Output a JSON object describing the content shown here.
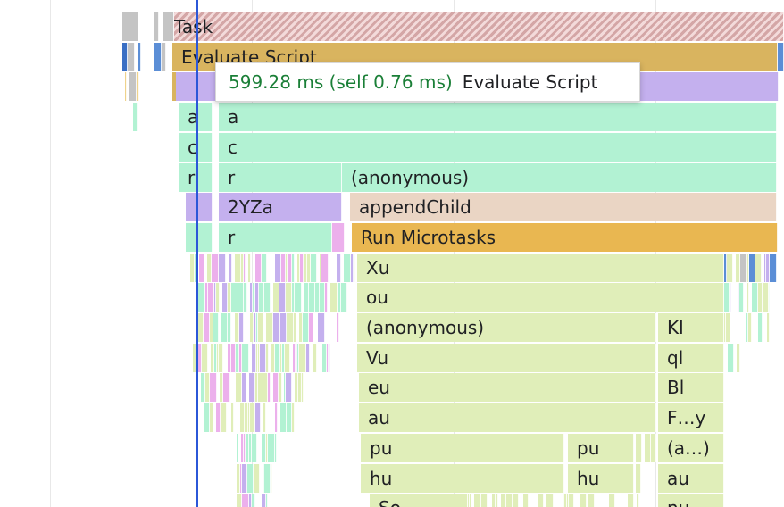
{
  "tooltip": {
    "time": "599.28 ms (self 0.76 ms)",
    "name": "Evaluate Script"
  },
  "labels": {
    "task": "Task",
    "evaluate_script": "Evaluate Script",
    "a_small": "a",
    "a": "a",
    "c_small": "c",
    "c": "c",
    "r_small": "r",
    "r": "r",
    "anonymous": "(anonymous)",
    "twoyza": "2YZa",
    "append_child": "appendChild",
    "r2": "r",
    "run_microtasks": "Run Microtasks",
    "xu": "Xu",
    "ou": "ou",
    "anonymous2": "(anonymous)",
    "kl": "Kl",
    "vu": "Vu",
    "ql": "ql",
    "eu": "eu",
    "bl": "Bl",
    "au": "au",
    "fy": "F…y",
    "pu": "pu",
    "pu2": "pu",
    "a_ellipsis": "(a…)",
    "hu": "hu",
    "hu2": "hu",
    "au2": "au",
    "so": "So",
    "nu": "nu"
  },
  "colors": {
    "task_gray": "#c4c4c4",
    "task_hatch": "#d4a6a6",
    "evaluate_script": "#d9b45f",
    "compile": "#c4b0ee",
    "js_green": "#b2f2d3",
    "js_lime": "#e0eeb9",
    "append_child": "#ead5c4",
    "run_microtasks": "#e9b751",
    "purple": "#c4b0ee",
    "pink": "#ecb0ec",
    "blue": "#5b8ed6",
    "cursor": "#2b57d8",
    "tooltip_time": "#1a7f37"
  }
}
